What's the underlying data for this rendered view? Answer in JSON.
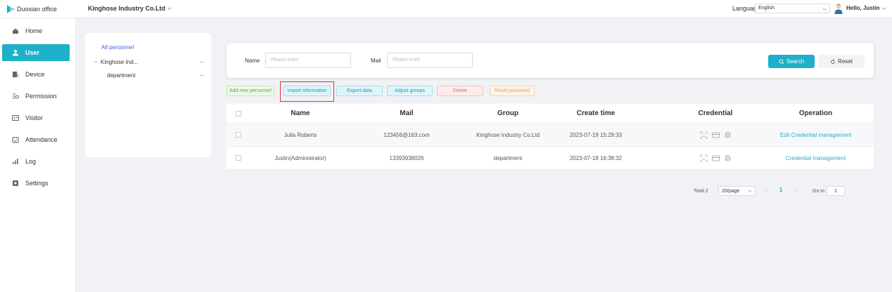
{
  "header": {
    "app_name": "Duoxian office",
    "company": "Kinghose Industry Co.Ltd",
    "language_label": "Language",
    "language_value": "English",
    "greeting": "Hello,  Justin"
  },
  "sidebar": {
    "items": [
      {
        "label": "Home",
        "icon": "home-icon"
      },
      {
        "label": "User",
        "icon": "user-icon",
        "active": true
      },
      {
        "label": "Device",
        "icon": "device-icon"
      },
      {
        "label": "Permission",
        "icon": "permission-icon"
      },
      {
        "label": "Visitor",
        "icon": "visitor-icon"
      },
      {
        "label": "Attendance",
        "icon": "attendance-icon"
      },
      {
        "label": "Log",
        "icon": "log-icon"
      },
      {
        "label": "Settings",
        "icon": "settings-icon"
      }
    ]
  },
  "tree": {
    "all_label": "All personnel",
    "nodes": [
      {
        "label": "Kinghose Ind...",
        "more": "···"
      },
      {
        "label": "department",
        "more": "···"
      }
    ]
  },
  "search": {
    "name_label": "Name",
    "name_placeholder": "Please enter",
    "mail_label": "Mail",
    "mail_placeholder": "Please enter",
    "search_button": "Search",
    "reset_button": "Reset"
  },
  "actions": {
    "add": "Add new personnel",
    "import": "Import information",
    "export": "Export data",
    "adjust": "Adjust groups",
    "delete": "Delete",
    "reset_password": "Reset password"
  },
  "table": {
    "columns": [
      "Name",
      "Mail",
      "Group",
      "Create time",
      "Credential",
      "Operation"
    ],
    "rows": [
      {
        "name": "Julia Roberts",
        "mail": "123456@163.com",
        "group": "Kinghose Industry Co.Ltd",
        "create_time": "2023-07-19 15:29:33",
        "operation": "Edit  Credential management"
      },
      {
        "name": "Justin(Administrator)",
        "mail": "13393938026",
        "group": "department",
        "create_time": "2023-07-18 16:38:32",
        "operation": "Credential management"
      }
    ]
  },
  "pagination": {
    "total": "Total 2",
    "page_size": "20/page",
    "current_page": "1",
    "goto_label": "Go to",
    "goto_value": "1"
  },
  "colors": {
    "accent": "#1fb0c9",
    "highlight_border": "#e03030"
  }
}
